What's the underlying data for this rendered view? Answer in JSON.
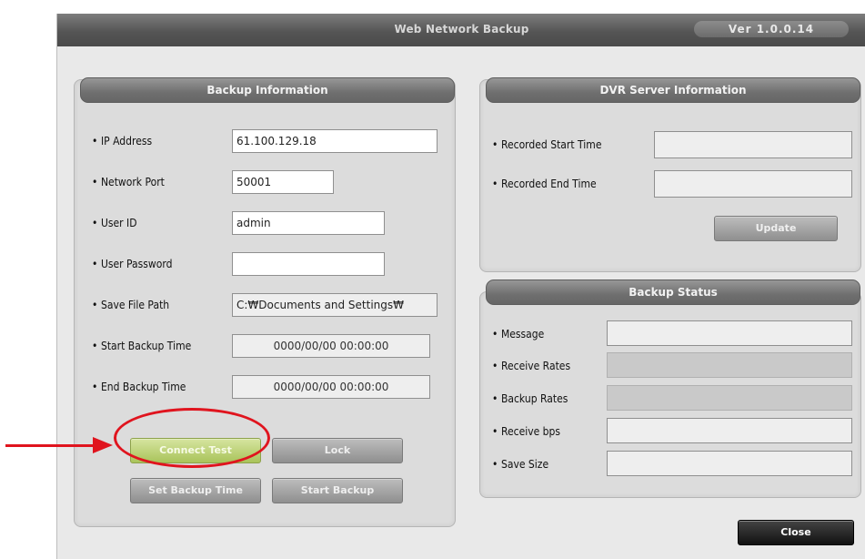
{
  "window": {
    "title": "Web Network Backup",
    "version": "Ver 1.0.0.14"
  },
  "backup_info": {
    "header": "Backup Information",
    "ip_address": {
      "label": "IP Address",
      "value": "61.100.129.18"
    },
    "network_port": {
      "label": "Network Port",
      "value": "50001"
    },
    "user_id": {
      "label": "User ID",
      "value": "admin"
    },
    "user_password": {
      "label": "User Password",
      "value": ""
    },
    "save_file_path": {
      "label": "Save File Path",
      "value": "C:₩Documents and Settings₩"
    },
    "start_backup_time": {
      "label": "Start Backup Time",
      "value": "0000/00/00 00:00:00"
    },
    "end_backup_time": {
      "label": "End Backup Time",
      "value": "0000/00/00 00:00:00"
    },
    "buttons": {
      "connect_test": "Connect Test",
      "lock": "Lock",
      "set_backup_time": "Set Backup Time",
      "start_backup": "Start Backup"
    }
  },
  "dvr_info": {
    "header": "DVR Server Information",
    "recorded_start": {
      "label": "Recorded Start Time",
      "value": ""
    },
    "recorded_end": {
      "label": "Recorded End Time",
      "value": ""
    },
    "update_label": "Update"
  },
  "backup_status": {
    "header": "Backup Status",
    "message": {
      "label": "Message",
      "value": ""
    },
    "receive_rates": {
      "label": "Receive Rates",
      "value": ""
    },
    "backup_rates": {
      "label": "Backup Rates",
      "value": ""
    },
    "receive_bps": {
      "label": "Receive bps",
      "value": ""
    },
    "save_size": {
      "label": "Save Size",
      "value": ""
    }
  },
  "close_label": "Close",
  "bullet": "•",
  "colors": {
    "annotation": "#e0141e",
    "connect_button": "#b8cf6a",
    "titlebar": "#555555"
  }
}
